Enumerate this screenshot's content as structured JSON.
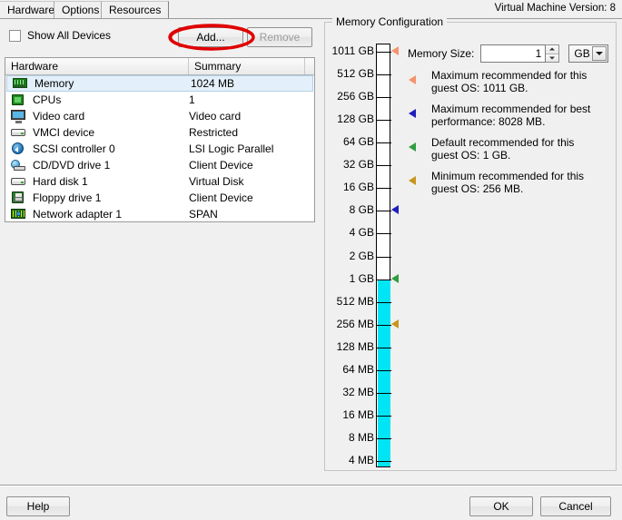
{
  "window": {
    "vm_version": "Virtual Machine Version: 8"
  },
  "tabs": [
    {
      "label": "Hardware",
      "active": true
    },
    {
      "label": "Options",
      "active": false
    },
    {
      "label": "Resources",
      "active": false
    }
  ],
  "toolbar": {
    "show_all_devices_label": "Show All Devices",
    "show_all_devices_checked": false,
    "add_label": "Add...",
    "remove_label": "Remove",
    "remove_enabled": false,
    "annotation": "red-ellipse-around-add-button"
  },
  "hardware_table": {
    "columns": [
      "Hardware",
      "Summary"
    ],
    "rows": [
      {
        "icon": "memory-icon",
        "name": "Memory",
        "summary": "1024 MB",
        "selected": true
      },
      {
        "icon": "cpu-icon",
        "name": "CPUs",
        "summary": "1",
        "selected": false
      },
      {
        "icon": "video-card-icon",
        "name": "Video card",
        "summary": "Video card",
        "selected": false
      },
      {
        "icon": "vmci-device-icon",
        "name": "VMCI device",
        "summary": "Restricted",
        "selected": false
      },
      {
        "icon": "scsi-controller-icon",
        "name": "SCSI controller 0",
        "summary": "LSI Logic Parallel",
        "selected": false
      },
      {
        "icon": "cd-dvd-drive-icon",
        "name": "CD/DVD drive 1",
        "summary": "Client Device",
        "selected": false
      },
      {
        "icon": "hard-disk-icon",
        "name": "Hard disk 1",
        "summary": "Virtual Disk",
        "selected": false
      },
      {
        "icon": "floppy-drive-icon",
        "name": "Floppy drive 1",
        "summary": "Client Device",
        "selected": false
      },
      {
        "icon": "network-adapter-icon",
        "name": "Network adapter 1",
        "summary": "SPAN",
        "selected": false
      }
    ]
  },
  "memory_configuration": {
    "group_title": "Memory Configuration",
    "memory_size_label": "Memory Size:",
    "memory_size_value": "1",
    "unit_selected": "GB",
    "unit_options": [
      "MB",
      "GB"
    ],
    "slider": {
      "ticks": [
        "1011 GB",
        "512 GB",
        "256 GB",
        "128 GB",
        "64 GB",
        "32 GB",
        "16 GB",
        "8 GB",
        "4 GB",
        "2 GB",
        "1 GB",
        "512 MB",
        "256 MB",
        "128 MB",
        "64 MB",
        "32 MB",
        "16 MB",
        "8 MB",
        "4 MB"
      ],
      "fill_color": "#00e5f5",
      "fill_from_tick": "1 GB",
      "fill_to_tick": "4 MB",
      "markers": [
        {
          "name": "maximum-recommended-marker",
          "tick": "1011 GB",
          "color": "#f4936c"
        },
        {
          "name": "best-performance-marker",
          "tick": "8 GB",
          "color": "#1f1fbe"
        },
        {
          "name": "default-recommended-marker",
          "tick": "1 GB",
          "color": "#2f9e3f"
        },
        {
          "name": "minimum-recommended-marker",
          "tick": "256 MB",
          "color": "#c8951e"
        }
      ]
    },
    "notes": [
      {
        "color": "#f4936c",
        "text": "Maximum recommended for this guest OS: 1011 GB."
      },
      {
        "color": "#1f1fbe",
        "text": "Maximum recommended for best performance: 8028 MB."
      },
      {
        "color": "#2f9e3f",
        "text": "Default recommended for this guest OS: 1 GB."
      },
      {
        "color": "#c8951e",
        "text": "Minimum recommended for this guest OS: 256 MB."
      }
    ]
  },
  "footer": {
    "help_label": "Help",
    "ok_label": "OK",
    "cancel_label": "Cancel"
  }
}
